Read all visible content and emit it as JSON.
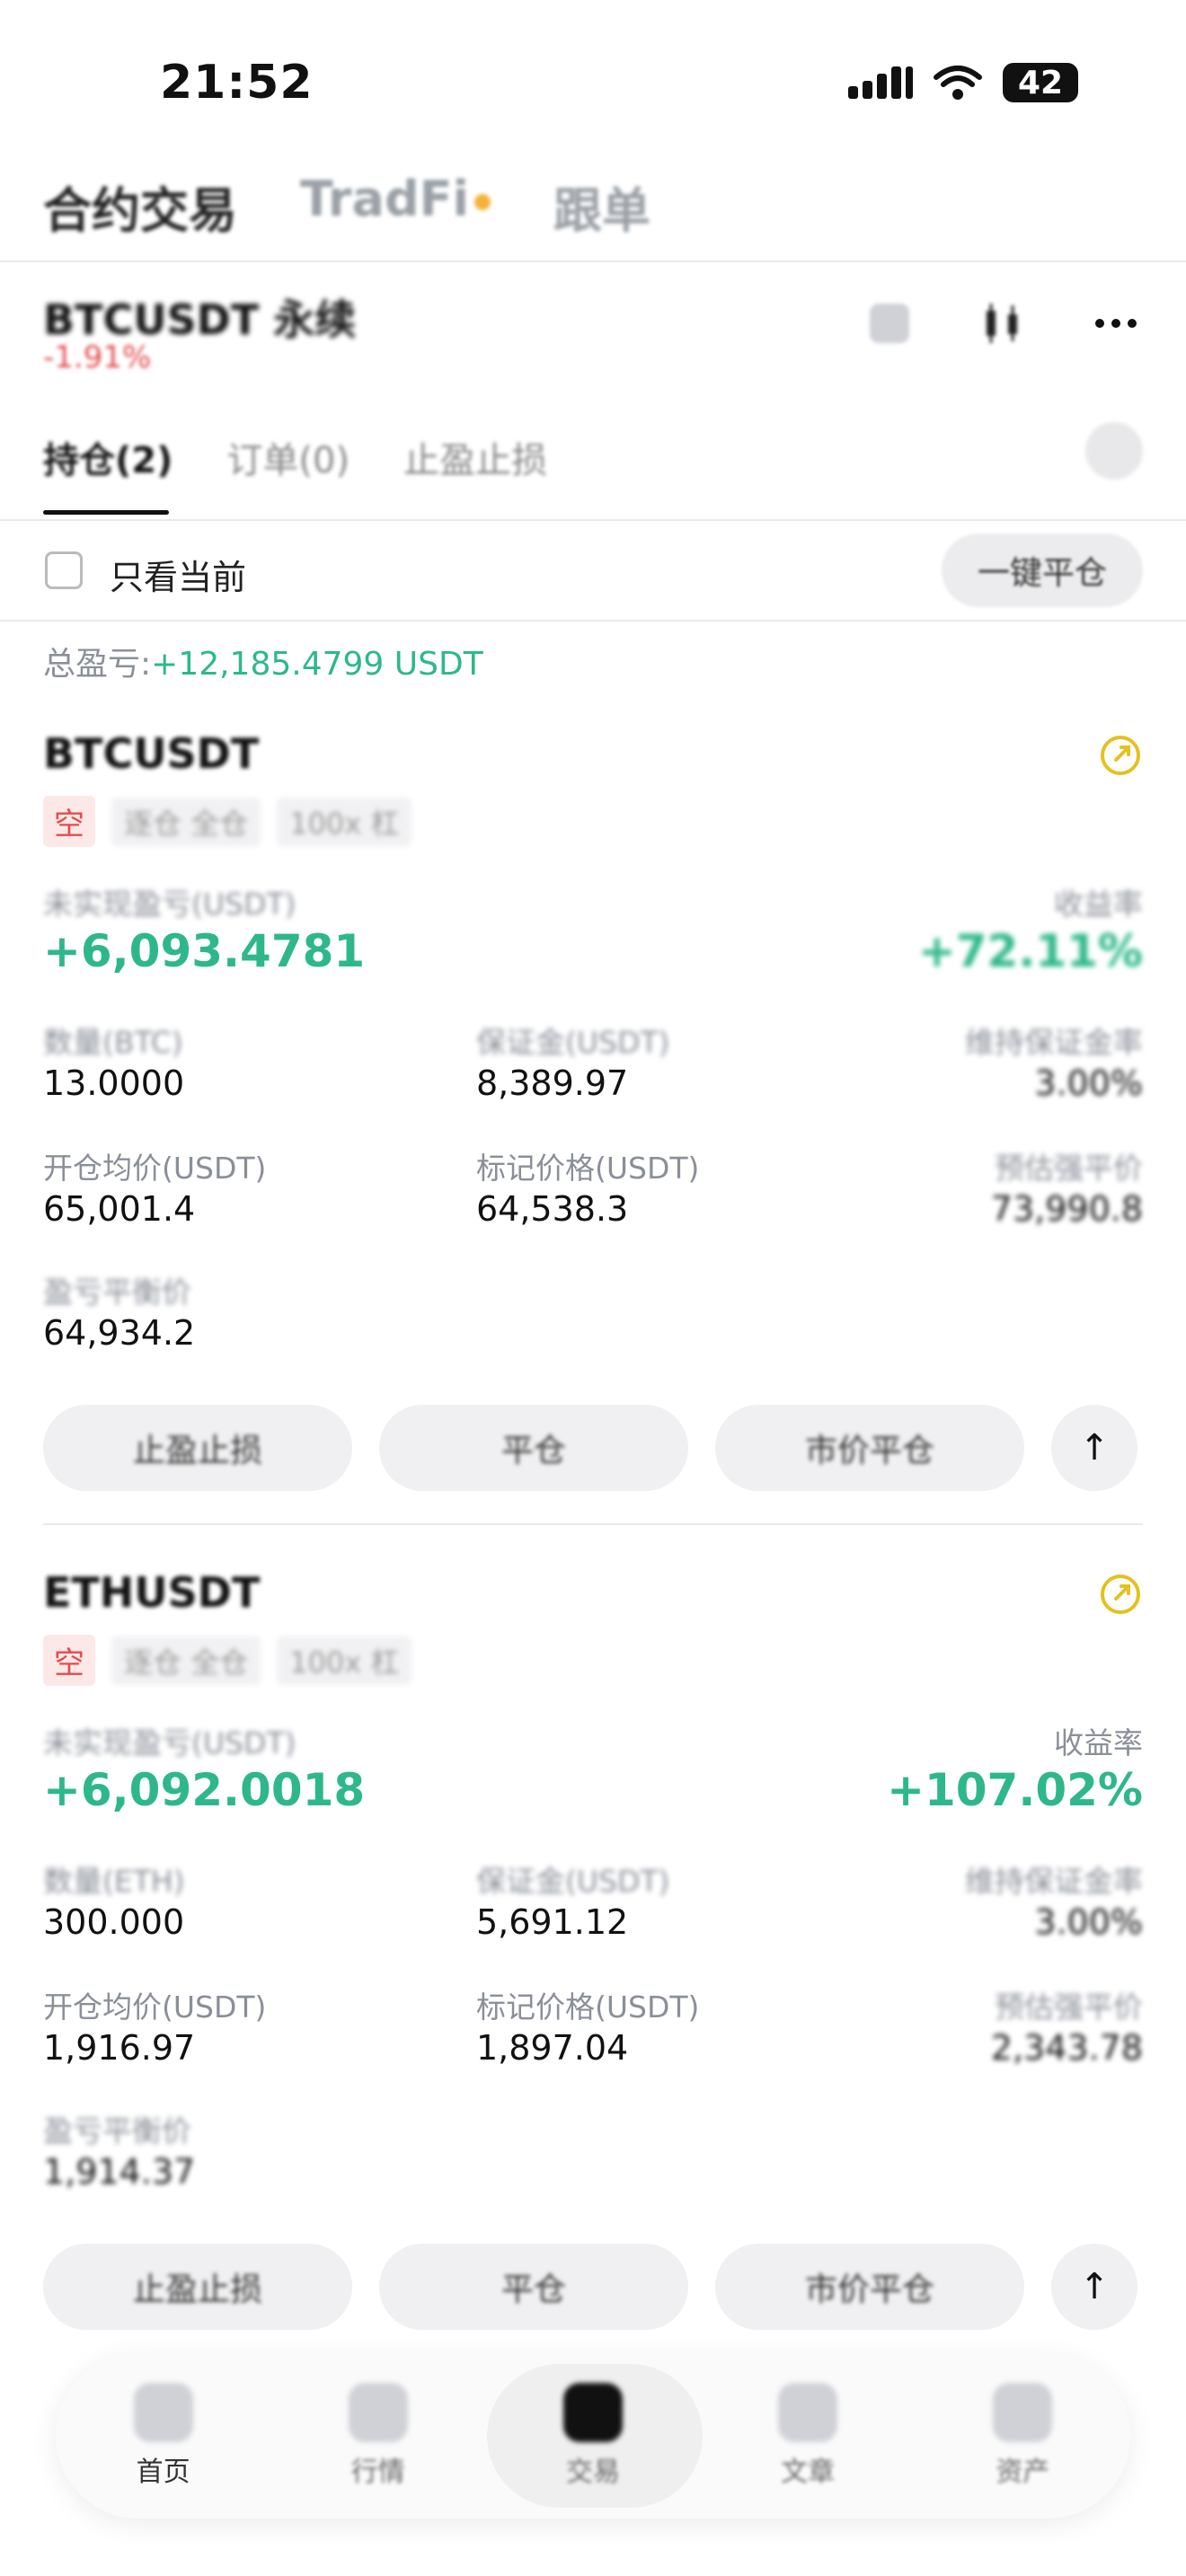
{
  "status_bar": {
    "time": "21:52",
    "battery": "42"
  },
  "top_tabs": [
    {
      "label": "合约交易"
    },
    {
      "label": "TradFi"
    },
    {
      "label": "跟单"
    }
  ],
  "pair_header": {
    "symbol": "BTCUSDT 永续",
    "change": "-1.91%"
  },
  "position_tabs": [
    {
      "label": "持仓(2)"
    },
    {
      "label": "订单(0)"
    },
    {
      "label": "止盈止损"
    }
  ],
  "filter": {
    "only_current": "只看当前",
    "close_all": "一键平仓"
  },
  "total_pnl": {
    "label": "总盈亏:",
    "value": "+12,185.4799 USDT"
  },
  "positions": [
    {
      "symbol": "BTCUSDT",
      "side": "空",
      "tag1": "逐仓 全仓",
      "tag2": "100x 杠",
      "unrealized_label": "未实现盈亏(USDT)",
      "unrealized": "+6,093.4781",
      "roe_label": "收益率",
      "roe": "+72.11%",
      "qty_label": "数量(BTC)",
      "qty": "13.0000",
      "margin_label": "保证金(USDT)",
      "margin": "8,389.97",
      "mmr_label": "维持保证金率",
      "mmr": "3.00%",
      "entry_label": "开仓均价(USDT)",
      "entry": "65,001.4",
      "mark_label": "标记价格(USDT)",
      "mark": "64,538.3",
      "liq_label": "预估强平价",
      "liq": "73,990.8",
      "be_label": "盈亏平衡价",
      "be": "64,934.2",
      "buttons": [
        "止盈止损",
        "平仓",
        "市价平仓"
      ]
    },
    {
      "symbol": "ETHUSDT",
      "side": "空",
      "tag1": "逐仓 全仓",
      "tag2": "100x 杠",
      "unrealized_label": "未实现盈亏(USDT)",
      "unrealized": "+6,092.0018",
      "roe_label": "收益率",
      "roe": "+107.02%",
      "qty_label": "数量(ETH)",
      "qty": "300.000",
      "margin_label": "保证金(USDT)",
      "margin": "5,691.12",
      "mmr_label": "维持保证金率",
      "mmr": "3.00%",
      "entry_label": "开仓均价(USDT)",
      "entry": "1,916.97",
      "mark_label": "标记价格(USDT)",
      "mark": "1,897.04",
      "liq_label": "预估强平价",
      "liq": "2,343.78",
      "be_label": "盈亏平衡价",
      "be": "1,914.37",
      "buttons": [
        "止盈止损",
        "平仓",
        "市价平仓"
      ]
    }
  ],
  "bottom_nav": [
    {
      "label": "首页"
    },
    {
      "label": "行情"
    },
    {
      "label": "交易"
    },
    {
      "label": "文章"
    },
    {
      "label": "资产"
    }
  ],
  "colors": {
    "green": "#2eb88a",
    "red": "#e24c4c",
    "yellow": "#e5c020"
  }
}
